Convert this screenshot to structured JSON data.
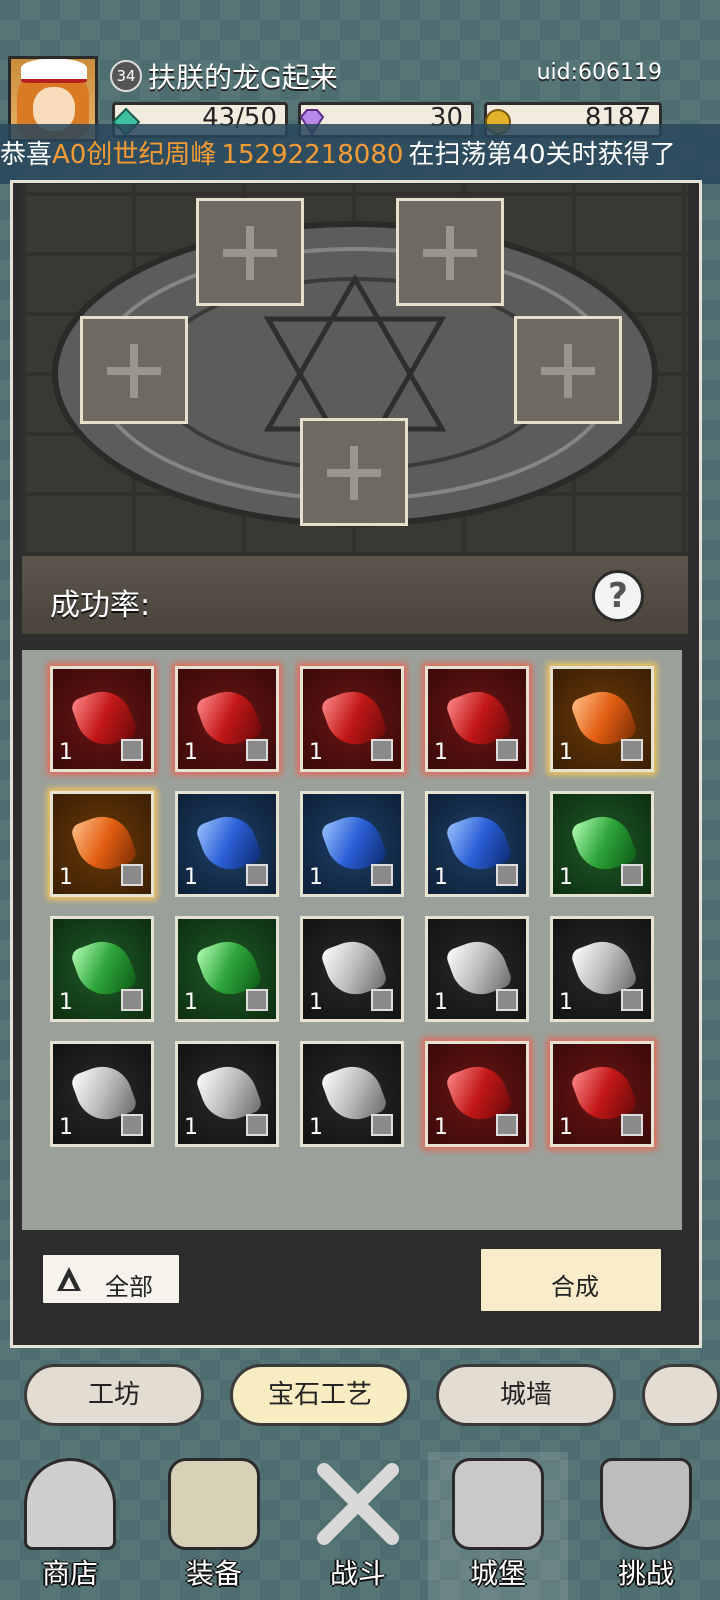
{
  "player": {
    "level": "34",
    "name": "扶朕的龙G起来",
    "uid": "uid:606119"
  },
  "resources": [
    {
      "name": "energy",
      "value": "43/50",
      "icon": "green-crystal-icon"
    },
    {
      "name": "gems",
      "value": "30",
      "icon": "purple-diamond-icon"
    },
    {
      "name": "gold",
      "value": "8187",
      "icon": "gold-coin-icon"
    }
  ],
  "ticker": {
    "part1": "恭喜",
    "highlight1": "A0创世纪周峰",
    "highlight2": "15292218080",
    "part2": "在扫荡第40关时获得了"
  },
  "forge": {
    "success_rate_label": "成功率:",
    "help_symbol": "?"
  },
  "inventory": {
    "rows": [
      [
        {
          "color": "red",
          "qty": "1"
        },
        {
          "color": "red",
          "qty": "1"
        },
        {
          "color": "red",
          "qty": "1"
        },
        {
          "color": "red",
          "qty": "1"
        },
        {
          "color": "orange",
          "qty": "1"
        }
      ],
      [
        {
          "color": "orange",
          "qty": "1"
        },
        {
          "color": "blue",
          "qty": "1"
        },
        {
          "color": "blue",
          "qty": "1"
        },
        {
          "color": "blue",
          "qty": "1"
        },
        {
          "color": "green",
          "qty": "1"
        }
      ],
      [
        {
          "color": "green",
          "qty": "1"
        },
        {
          "color": "green",
          "qty": "1"
        },
        {
          "color": "white",
          "qty": "1"
        },
        {
          "color": "white",
          "qty": "1"
        },
        {
          "color": "white",
          "qty": "1"
        }
      ],
      [
        {
          "color": "white",
          "qty": "1"
        },
        {
          "color": "white",
          "qty": "1"
        },
        {
          "color": "white",
          "qty": "1"
        },
        {
          "color": "red",
          "qty": "1"
        },
        {
          "color": "red",
          "qty": "1"
        }
      ]
    ]
  },
  "buttons": {
    "filter_label": "全部",
    "compose_label": "合成"
  },
  "subtabs": [
    {
      "label": "工坊"
    },
    {
      "label": "宝石工艺"
    },
    {
      "label": "城墙"
    }
  ],
  "nav": [
    {
      "label": "商店"
    },
    {
      "label": "装备"
    },
    {
      "label": "战斗"
    },
    {
      "label": "城堡"
    },
    {
      "label": "挑战"
    }
  ],
  "colors": {
    "ticker_highlight": "#f39c35",
    "active_tab": "#f8ecc2"
  }
}
